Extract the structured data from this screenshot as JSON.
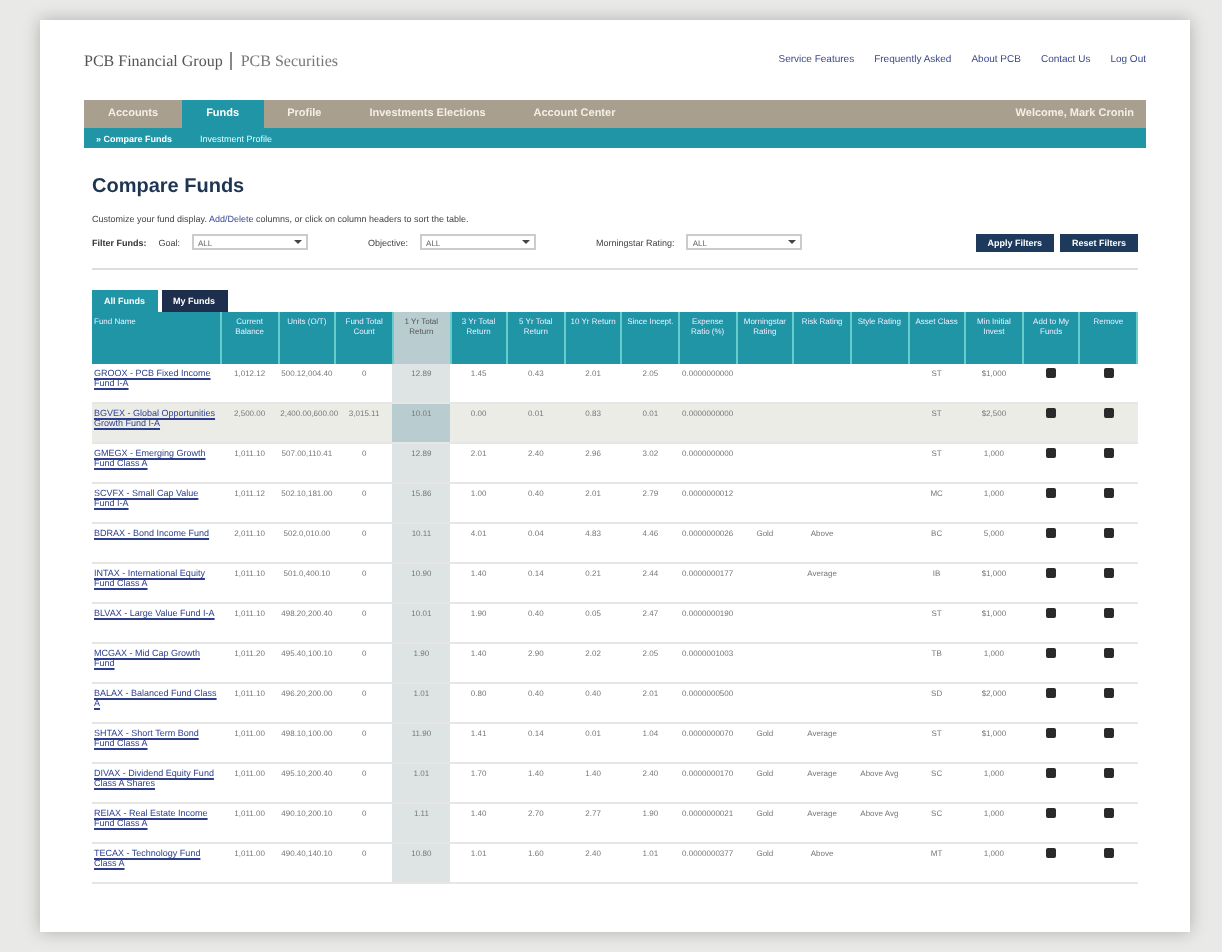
{
  "header": {
    "logo": "PCB Financial Group",
    "logo_sub": "PCB Securities",
    "links": [
      "Service Features",
      "Frequently Asked",
      "About PCB",
      "Contact Us",
      "Log Out"
    ]
  },
  "nav": {
    "tabs": [
      {
        "label": "Accounts",
        "selected": false
      },
      {
        "label": "Funds",
        "selected": true
      },
      {
        "label": "Profile",
        "selected": false
      },
      {
        "label": "Investments Elections",
        "selected": false
      },
      {
        "label": "Account Center",
        "selected": false
      }
    ],
    "welcome": "Welcome, Mark Cronin"
  },
  "subnav": [
    {
      "label": "» Compare Funds",
      "selected": true
    },
    {
      "label": "Investment Profile",
      "selected": false
    }
  ],
  "title": "Compare Funds",
  "intro": "Customize your fund display. **Add/Delete** columns, or click on column headers to sort the table.",
  "filters": {
    "label": "Filter Funds:",
    "fields": [
      {
        "label": "Goal:",
        "value": "ALL"
      },
      {
        "label": "Objective:",
        "value": "ALL"
      },
      {
        "label": "Morningstar Rating:",
        "value": "ALL"
      }
    ],
    "buttons": [
      "Apply Filters",
      "Reset Filters"
    ]
  },
  "table_tabs": [
    {
      "label": "All Funds",
      "selected": true
    },
    {
      "label": "My Funds",
      "selected": false
    }
  ],
  "table": {
    "columns": [
      {
        "label": "Fund Name",
        "highlight": false
      },
      {
        "label": "Current Balance",
        "highlight": false
      },
      {
        "label": "Units (O/T)",
        "highlight": false
      },
      {
        "label": "Fund Total Count",
        "highlight": false
      },
      {
        "label": "1 Yr Total Return",
        "highlight": true
      },
      {
        "label": "3 Yr Total Return",
        "highlight": false
      },
      {
        "label": "5 Yr Total Return",
        "highlight": false
      },
      {
        "label": "10 Yr Return",
        "highlight": false
      },
      {
        "label": "Since Incept.",
        "highlight": false
      },
      {
        "label": "Expense Ratio (%)",
        "highlight": false
      },
      {
        "label": "Morningstar Rating",
        "highlight": false
      },
      {
        "label": "Risk Rating",
        "highlight": false
      },
      {
        "label": "Style Rating",
        "highlight": false
      },
      {
        "label": "Asset Class",
        "highlight": false
      },
      {
        "label": "Min Initial Invest",
        "highlight": false
      },
      {
        "label": "Add to My Funds",
        "highlight": false
      },
      {
        "label": "Remove",
        "highlight": false
      }
    ],
    "rows": [
      {
        "selected": false,
        "cells": [
          "GROOX - PCB Fixed Income Fund I-A",
          "1,012.12",
          "500.12,004.40",
          "0",
          "12.89",
          "1.45",
          "0.43",
          "2.01",
          "2.05",
          "0.0000000000",
          "",
          "",
          "",
          "ST",
          "$1,000",
          "",
          ""
        ]
      },
      {
        "selected": true,
        "cells": [
          "BGVEX - Global Opportunities Growth Fund I-A",
          "2,500.00",
          "2,400.00,600.00",
          "3,015.11",
          "10.01",
          "0.00",
          "0.01",
          "0.83",
          "0.01",
          "0.0000000000",
          "",
          "",
          "",
          "ST",
          "$2,500",
          "",
          ""
        ]
      },
      {
        "selected": false,
        "cells": [
          "GMEGX - Emerging Growth Fund Class A",
          "1,011.10",
          "507.00,110.41",
          "0",
          "12.89",
          "2.01",
          "2.40",
          "2.96",
          "3.02",
          "0.0000000000",
          "",
          "",
          "",
          "ST",
          "1,000",
          "",
          ""
        ]
      },
      {
        "selected": false,
        "cells": [
          "SCVFX - Small Cap Value Fund I-A",
          "1,011.12",
          "502.10,181.00",
          "0",
          "15.86",
          "1.00",
          "0.40",
          "2.01",
          "2.79",
          "0.0000000012",
          "",
          "",
          "",
          "MC",
          "1,000",
          "",
          ""
        ]
      },
      {
        "selected": false,
        "cells": [
          "BDRAX - Bond Income Fund",
          "2,011.10",
          "502.0,010.00",
          "0",
          "10.11",
          "4.01",
          "0.04",
          "4.83",
          "4.46",
          "0.0000000026",
          "Gold",
          "Above",
          "",
          "BC",
          "5,000",
          "",
          ""
        ]
      },
      {
        "selected": false,
        "cells": [
          "INTAX - International Equity Fund Class A",
          "1,011.10",
          "501.0,400.10",
          "0",
          "10.90",
          "1.40",
          "0.14",
          "0.21",
          "2.44",
          "0.0000000177",
          "",
          "Average",
          "",
          "IB",
          "$1,000",
          "",
          ""
        ]
      },
      {
        "selected": false,
        "cells": [
          "BLVAX - Large Value Fund I-A",
          "1,011.10",
          "498.20,200.40",
          "0",
          "10.01",
          "1.90",
          "0.40",
          "0.05",
          "2.47",
          "0.0000000190",
          "",
          "",
          "",
          "ST",
          "$1,000",
          "",
          ""
        ]
      },
      {
        "selected": false,
        "cells": [
          "MCGAX - Mid Cap Growth Fund",
          "1,011.20",
          "495.40,100.10",
          "0",
          "1.90",
          "1.40",
          "2.90",
          "2.02",
          "2.05",
          "0.0000001003",
          "",
          "",
          "",
          "TB",
          "1,000",
          "",
          ""
        ]
      },
      {
        "selected": false,
        "cells": [
          "BALAX - Balanced Fund Class A",
          "1,011.10",
          "496.20,200.00",
          "0",
          "1.01",
          "0.80",
          "0.40",
          "0.40",
          "2.01",
          "0.0000000500",
          "",
          "",
          "",
          "SD",
          "$2,000",
          "",
          ""
        ]
      },
      {
        "selected": false,
        "cells": [
          "SHTAX - Short Term Bond Fund Class A",
          "1,011.00",
          "498.10,100.00",
          "0",
          "11.90",
          "1.41",
          "0.14",
          "0.01",
          "1.04",
          "0.0000000070",
          "Gold",
          "Average",
          "",
          "ST",
          "$1,000",
          "",
          ""
        ]
      },
      {
        "selected": false,
        "cells": [
          "DIVAX - Dividend Equity Fund Class A Shares",
          "1,011.00",
          "495.10,200.40",
          "0",
          "1.01",
          "1.70",
          "1.40",
          "1.40",
          "2.40",
          "0.0000000170",
          "Gold",
          "Average",
          "Above Avg",
          "SC",
          "1,000",
          "",
          ""
        ]
      },
      {
        "selected": false,
        "cells": [
          "REIAX - Real Estate Income Fund Class A",
          "1,011.00",
          "490.10,200.10",
          "0",
          "1.11",
          "1.40",
          "2.70",
          "2.77",
          "1.90",
          "0.0000000021",
          "Gold",
          "Average",
          "Above Avg",
          "SC",
          "1,000",
          "",
          ""
        ]
      },
      {
        "selected": false,
        "cells": [
          "TECAX - Technology Fund Class A",
          "1,011.00",
          "490.40,140.10",
          "0",
          "10.80",
          "1.01",
          "1.60",
          "2.40",
          "1.01",
          "0.0000000377",
          "Gold",
          "Above",
          "",
          "MT",
          "1,000",
          "",
          ""
        ]
      }
    ]
  }
}
